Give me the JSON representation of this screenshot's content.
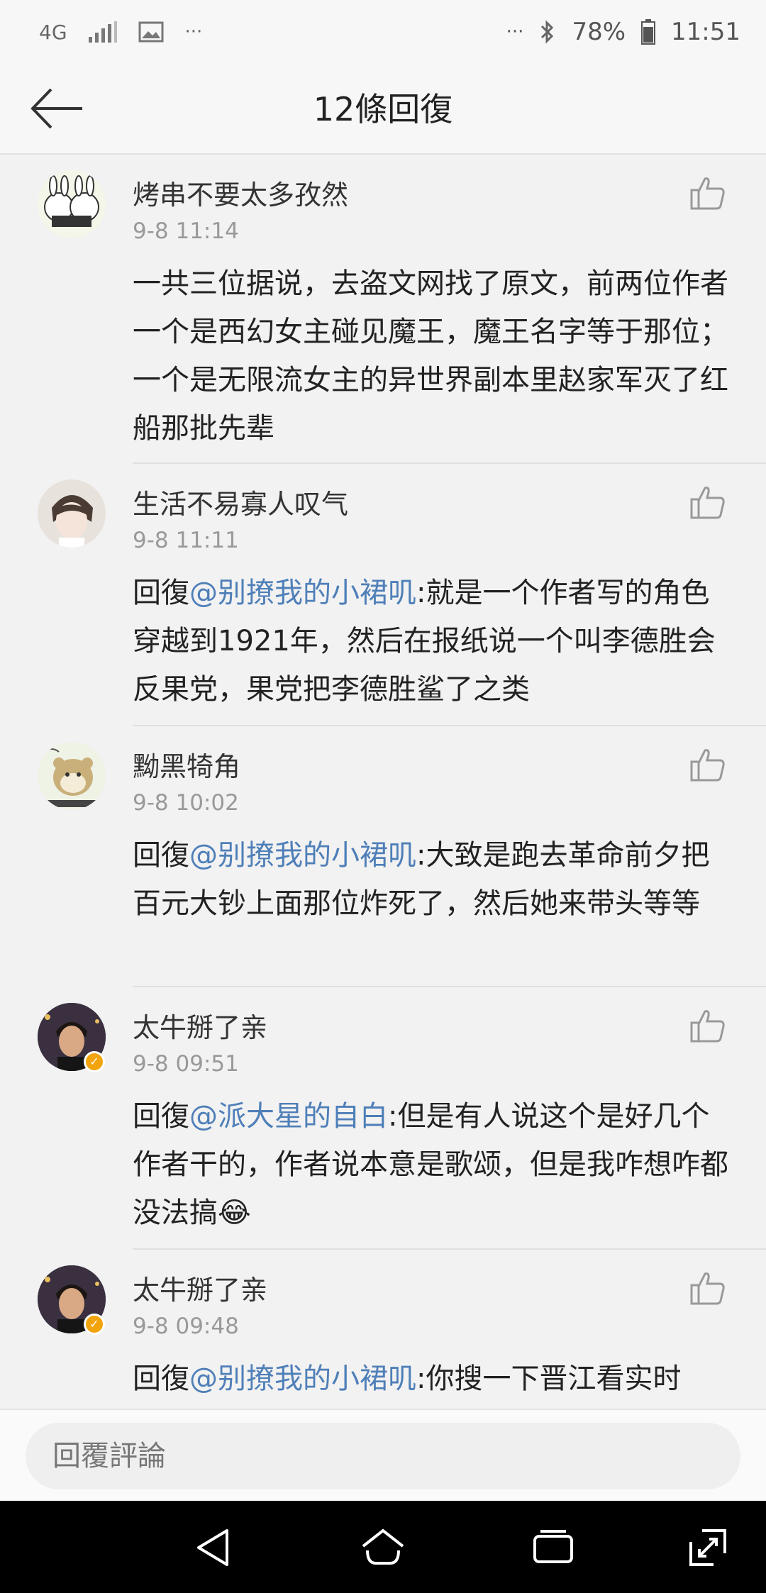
{
  "status_bar": {
    "network": "4G",
    "more": "···",
    "more_right": "···",
    "battery": "78%",
    "time": "11:51"
  },
  "header": {
    "title": "12條回復"
  },
  "comments": [
    {
      "name": "烤串不要太多孜然",
      "time": "9-8 11:14",
      "mention": "",
      "text": "一共三位据说，去盗文网找了原文，前两位作者一个是西幻女主碰见魔王，魔王名字等于那位；一个是无限流女主的异世界副本里赵家军灭了红船那批先辈"
    },
    {
      "name": "生活不易寡人叹气",
      "time": "9-8 11:11",
      "prefix": "回復",
      "mention": "@别撩我的小裙叽",
      "text": ":就是一个作者写的角色穿越到1921年，然后在报纸说一个叫李德胜会反果党，果党把李德胜鲨了之类"
    },
    {
      "name": "黝黑犄角",
      "time": "9-8 10:02",
      "prefix": "回復",
      "mention": "@别撩我的小裙叽",
      "text": ":大致是跑去革命前夕把百元大钞上面那位炸死了，然后她来带头等等"
    },
    {
      "name": "太牛掰了亲",
      "time": "9-8 09:51",
      "prefix": "回復",
      "mention": "@派大星的自白",
      "text": ":但是有人说这个是好几个作者干的，作者说本意是歌颂，但是我咋想咋都没法搞",
      "emoji": "😂"
    },
    {
      "name": "太牛掰了亲",
      "time": "9-8 09:48",
      "prefix": "回復",
      "mention": "@别撩我的小裙叽",
      "text": ":你搜一下晋江看实时"
    }
  ],
  "reply": {
    "placeholder": "回覆評論"
  },
  "colors": {
    "mention": "#4f7fb8",
    "badge": "#f2a40c"
  }
}
